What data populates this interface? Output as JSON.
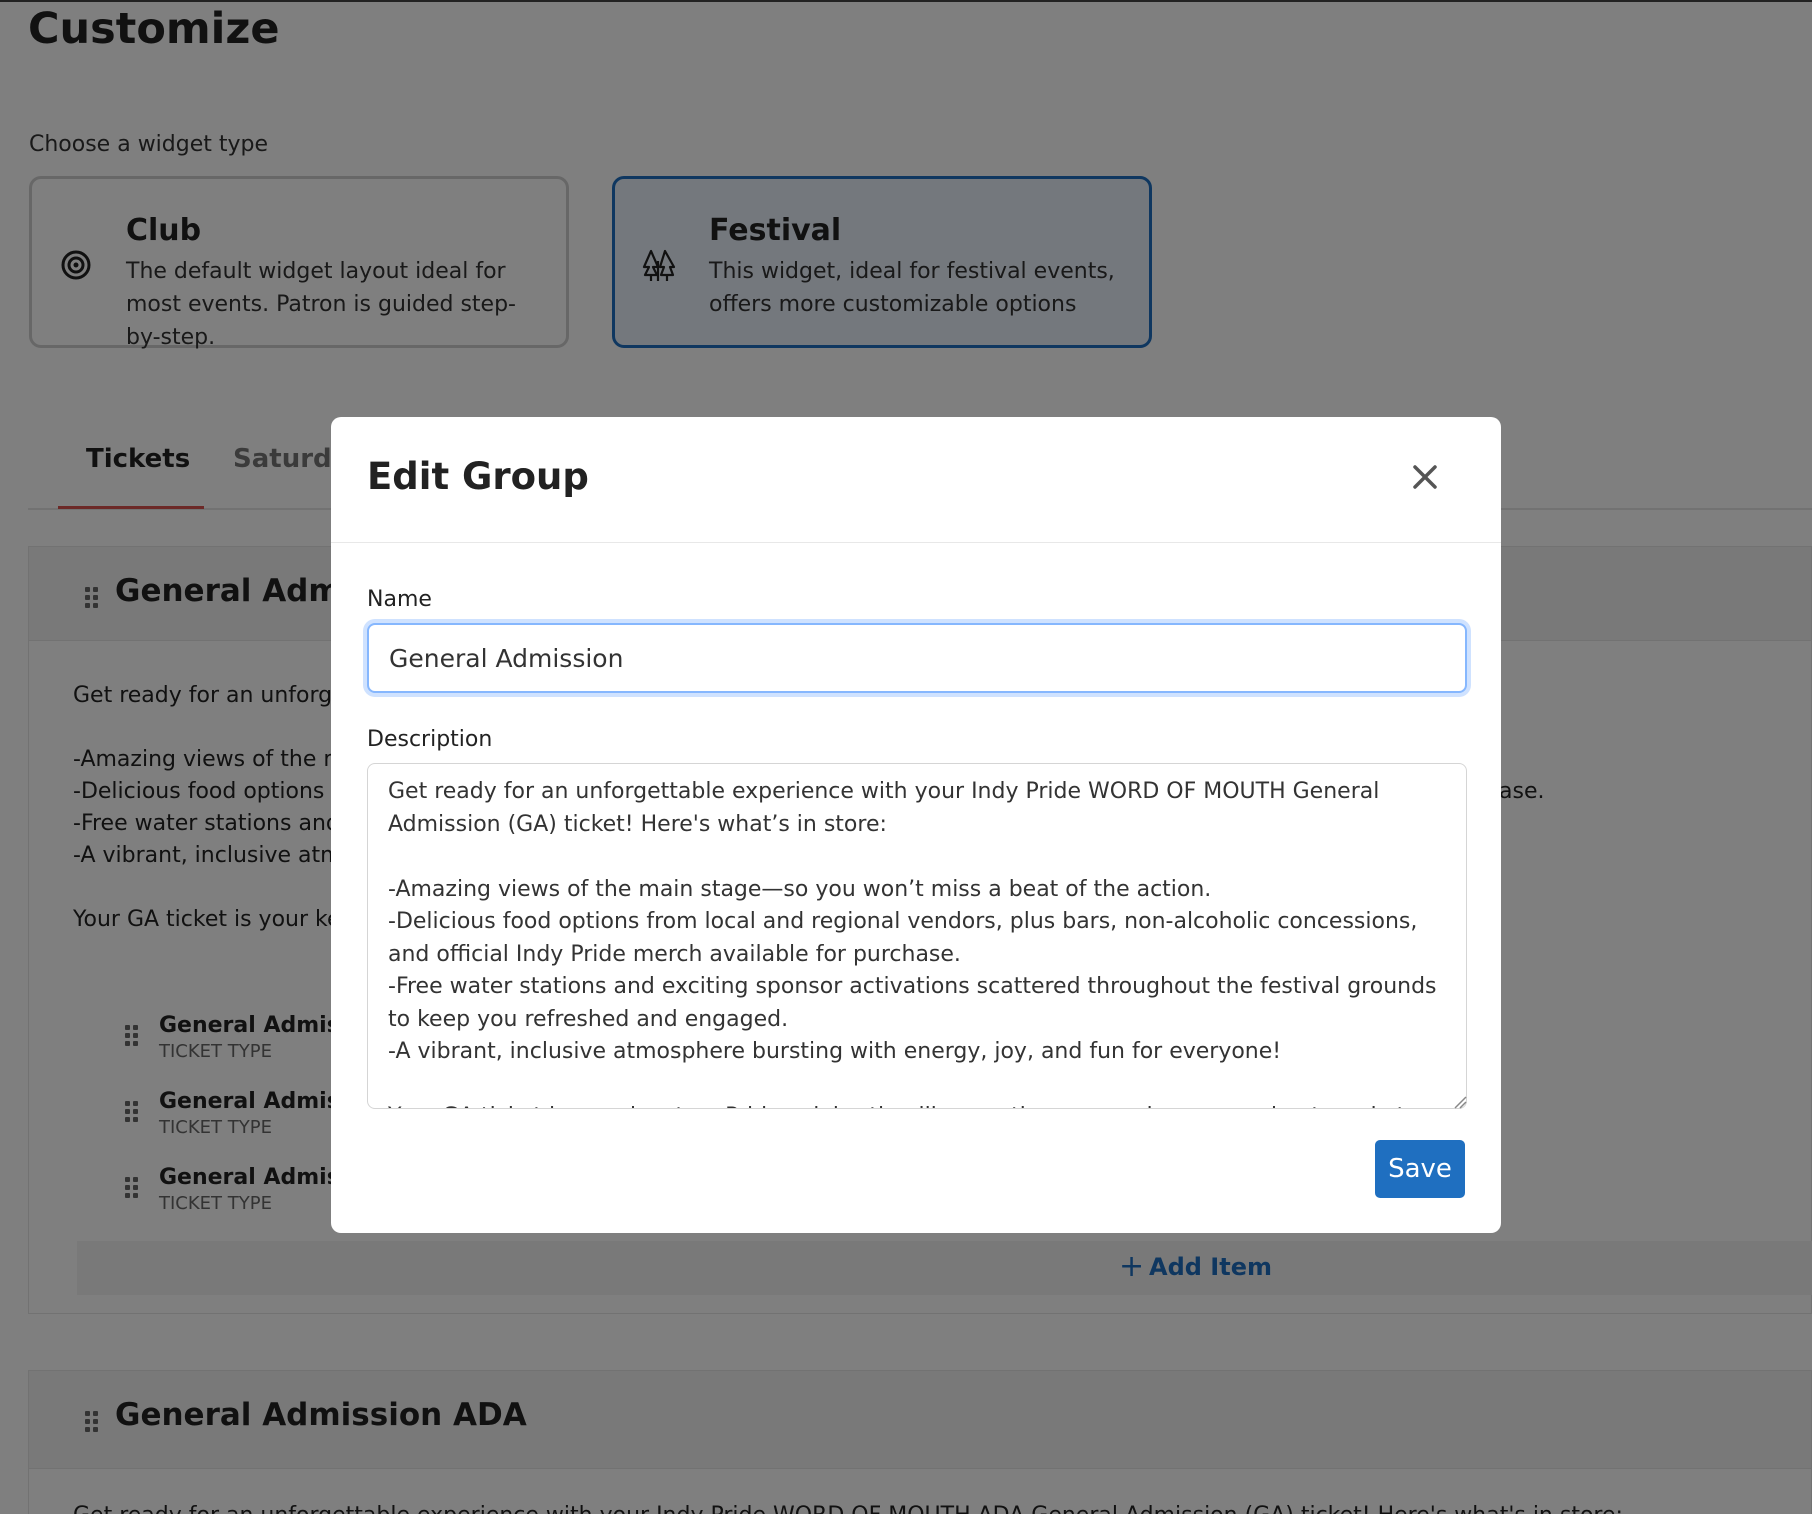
{
  "page": {
    "title": "Customize",
    "widget_type_label": "Choose a widget type",
    "widget_types": [
      {
        "title": "Club",
        "description": "The default widget layout ideal for most events. Patron is guided step-by-step.",
        "icon": "target-icon",
        "selected": false
      },
      {
        "title": "Festival",
        "description": "This widget, ideal for festival events, offers more customizable options",
        "icon": "trees-icon",
        "selected": true
      }
    ],
    "tabs": [
      {
        "label": "Tickets",
        "active": true
      },
      {
        "label": "Saturda",
        "active": false
      }
    ]
  },
  "groups": [
    {
      "title": "General Admiss",
      "description_lines": [
        "Get ready for an unforget",
        "-Amazing views of the ma",
        "-Delicious food options fr",
        "-Free water stations and e",
        "-A vibrant, inclusive atmos",
        "Your GA ticket is your key"
      ],
      "overflow_text": "ase.",
      "items": [
        {
          "name": "General Admission",
          "type": "TICKET TYPE"
        },
        {
          "name": "General Admission",
          "type": "TICKET TYPE"
        },
        {
          "name": "General Admission",
          "type": "TICKET TYPE"
        }
      ],
      "add_item_label": "Add Item"
    },
    {
      "title": "General Admission ADA",
      "description_partial": "Get ready for an unforgettable experience with your Indy Pride WORD OF MOUTH ADA General Admission (GA) ticket! Here's what's in store:"
    }
  ],
  "modal": {
    "title": "Edit Group",
    "name_label": "Name",
    "name_value": "General Admission",
    "description_label": "Description",
    "description_value": "Get ready for an unforgettable experience with your Indy Pride WORD OF MOUTH General Admission (GA) ticket! Here's what’s in store:\n\n-Amazing views of the main stage—so you won’t miss a beat of the action.\n-Delicious food options from local and regional vendors, plus bars, non-alcoholic concessions, and official Indy Pride merch available for purchase.\n-Free water stations and exciting sponsor activations scattered throughout the festival grounds to keep you refreshed and engaged.\n-A vibrant, inclusive atmosphere bursting with energy, joy, and fun for everyone!\n\nYour GA ticket is your key to a Pride celebration like no other—so grab yours and get ready to shine!",
    "save_label": "Save"
  },
  "colors": {
    "accent": "#1f6fc0",
    "tab_underline": "#d9534f",
    "overlay": "rgba(0,0,0,0.5)"
  }
}
